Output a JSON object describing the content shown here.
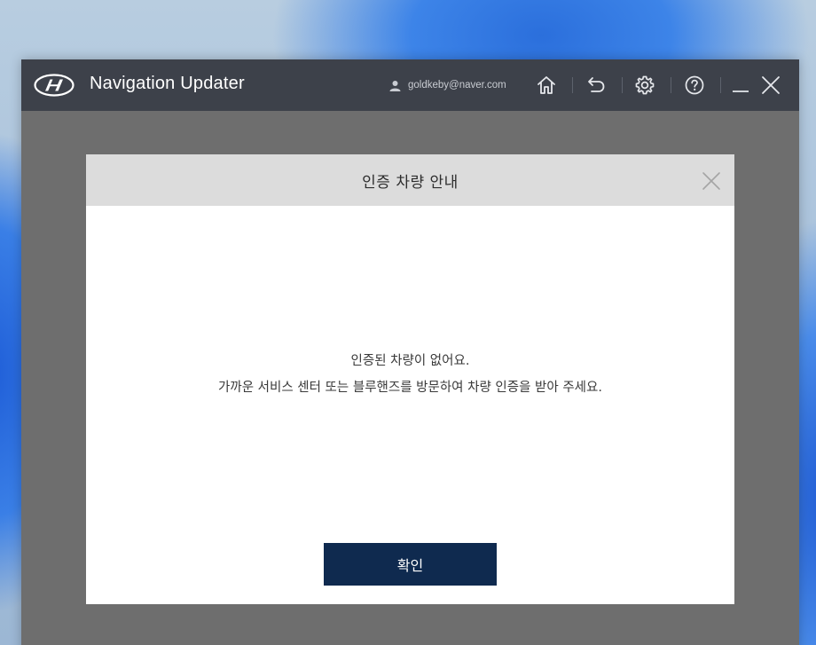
{
  "app": {
    "title": "Navigation Updater",
    "user_email": "goldkeby@naver.com"
  },
  "titlebar": {
    "icons": [
      "hyundai-logo-icon",
      "user-icon",
      "home-icon",
      "back-icon",
      "gear-icon",
      "help-icon",
      "minimize-icon",
      "close-icon"
    ]
  },
  "dialog": {
    "title": "인증 차량 안내",
    "message_line1": "인증된 차량이 없어요.",
    "message_line2": "가까운 서비스 센터 또는 블루핸즈를 방문하여 차량 인증을 받아 주세요.",
    "confirm_label": "확인"
  },
  "colors": {
    "titlebar": "#3d414a",
    "overlay": "#6e6e6e",
    "dialog_header": "#dcdcdc",
    "confirm_button": "#0f2a4f"
  }
}
